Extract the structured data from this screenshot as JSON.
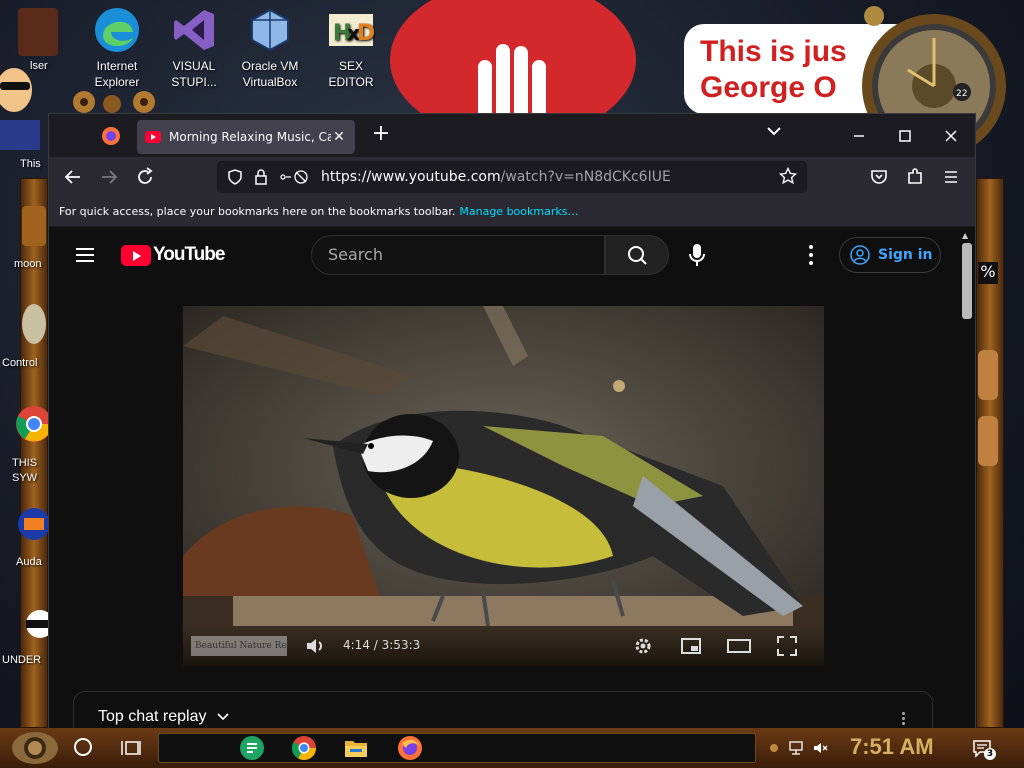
{
  "desktop": {
    "icons": [
      {
        "label_line1": "Internet",
        "label_line2": "Explorer"
      },
      {
        "label_line1": "VISUAL",
        "label_line2": "STUPI..."
      },
      {
        "label_line1": "Oracle VM",
        "label_line2": "VirtualBox"
      },
      {
        "label_line1": "SEX",
        "label_line2": "EDITOR"
      }
    ],
    "partial_labels": [
      "lser",
      "This",
      "moon",
      "Control",
      "THIS",
      "SYW",
      "Auda",
      "UNDER"
    ],
    "banner_quote_line1": "This is jus",
    "banner_quote_line2": "George O",
    "percent_fragment": "%"
  },
  "browser": {
    "tab_title": "Morning Relaxing Music, Calm",
    "tab_close": "✕",
    "new_tab": "+",
    "url_host": "https://www.youtube.com",
    "url_path": "/watch?v=nN8dCKc6IUE",
    "bookmarks_message": "For quick access, place your bookmarks here on the bookmarks toolbar.",
    "bookmarks_link": "Manage bookmarks…"
  },
  "youtube": {
    "logo_text": "YouTube",
    "search_placeholder": "Search",
    "sign_in": "Sign in",
    "video": {
      "channel_watermark": "Beautiful Nature Re",
      "time_current": "4:14",
      "time_sep": " / ",
      "time_total": "3:53:3"
    },
    "chat_replay": "Top chat replay"
  },
  "taskbar": {
    "clock": "7:51 AM",
    "notification_count": "3"
  },
  "colors": {
    "youtube_red": "#ff0033",
    "link_blue": "#3ea6ff",
    "manage_link": "#00ddff",
    "clock_gold": "#d4b060"
  }
}
